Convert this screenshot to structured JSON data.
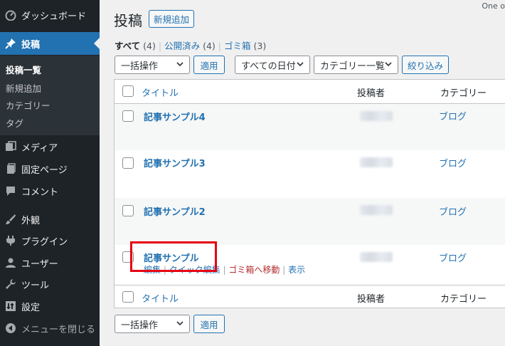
{
  "sidebar": {
    "dashboard": "ダッシュボード",
    "posts": "投稿",
    "submenu": {
      "all_posts": "投稿一覧",
      "add_new": "新規追加",
      "categories": "カテゴリー",
      "tags": "タグ"
    },
    "media": "メディア",
    "pages": "固定ページ",
    "comments": "コメント",
    "appearance": "外観",
    "plugins": "プラグイン",
    "users": "ユーザー",
    "tools": "ツール",
    "settings": "設定",
    "collapse": "メニューを閉じる"
  },
  "header": {
    "title": "投稿",
    "add_new": "新規追加",
    "screen_options": "One o"
  },
  "filters": {
    "all": "すべて",
    "all_count": "(4)",
    "published": "公開済み",
    "published_count": "(4)",
    "trash": "ゴミ箱",
    "trash_count": "(3)"
  },
  "tablenav_top": {
    "bulk_action": "一括操作",
    "apply": "適用",
    "dates": "すべての日付",
    "category": "カテゴリー一覧",
    "filter": "絞り込み"
  },
  "table": {
    "columns": {
      "title": "タイトル",
      "author": "投稿者",
      "categories": "カテゴリー"
    },
    "rows": [
      {
        "title": "記事サンプル4",
        "category": "ブログ"
      },
      {
        "title": "記事サンプル3",
        "category": "ブログ"
      },
      {
        "title": "記事サンプル2",
        "category": "ブログ"
      },
      {
        "title": "記事サンプル",
        "category": "ブログ"
      }
    ],
    "row_actions": {
      "edit": "編集",
      "quick_edit": "クイック編集",
      "trash": "ゴミ箱へ移動",
      "view": "表示"
    }
  },
  "tablenav_bottom": {
    "bulk_action": "一括操作",
    "apply": "適用"
  },
  "colors": {
    "sidebar_bg": "#1d2327",
    "accent": "#2271b1",
    "highlight": "#e60012"
  }
}
